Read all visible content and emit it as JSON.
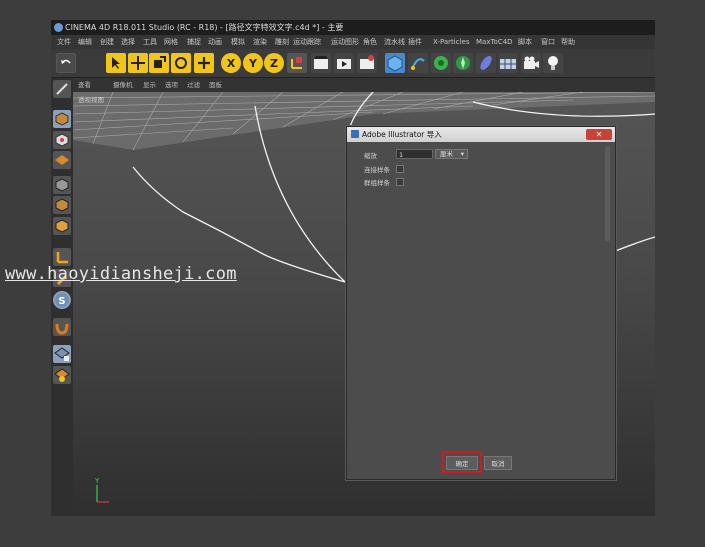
{
  "window": {
    "title": "CINEMA 4D R18.011 Studio (RC - R18) - [路径文字特效文字.c4d *] - 主要"
  },
  "menubar": {
    "items": [
      "文件",
      "编辑",
      "创建",
      "选择",
      "工具",
      "网格",
      "捕捉",
      "动画",
      "模拟",
      "渲染",
      "雕刻",
      "运动跟踪",
      "运动图形",
      "角色",
      "流水线",
      "插件",
      "X-Particles",
      "MaxToC4D",
      "脚本",
      "窗口",
      "帮助"
    ]
  },
  "viewport": {
    "menu": [
      "查看",
      "摄像机",
      "显示",
      "选项",
      "过滤",
      "面板"
    ],
    "label": "透视视图",
    "axis_y": "Y"
  },
  "dialog": {
    "title": "Adobe Illustrator 导入",
    "close_label": "✕",
    "scale_label": "缩放",
    "scale_value": "1",
    "unit_value": "厘米",
    "connect_label": "连接样条",
    "group_label": "群组样条",
    "ok_label": "确定",
    "cancel_label": "取消"
  },
  "watermark": {
    "text": "www.haoyidiansheji.com"
  }
}
